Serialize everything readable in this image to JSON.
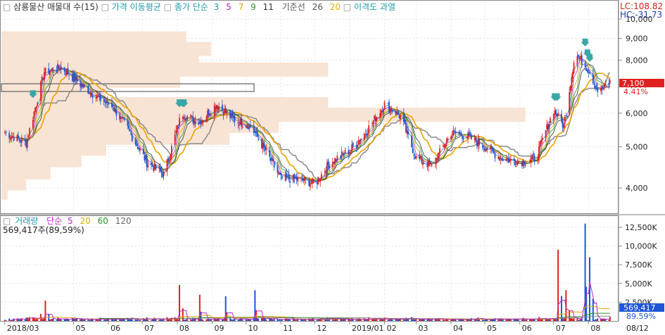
{
  "price_panel": {
    "legend": {
      "title": "삼룡물산 매물대 수(15)",
      "ma_title": "가격 이동평균",
      "ma_type": "종가 단순",
      "periods": [
        "3",
        "5",
        "7",
        "9",
        "11"
      ],
      "base_label": "기준선",
      "base_values": [
        "26",
        "20"
      ],
      "disparity": "이격도 과열"
    },
    "lc": "LC:108.82",
    "hc": "HC:-31.73",
    "price_badge": "7,100",
    "change_pct": "4.41%"
  },
  "volume_panel": {
    "legend": {
      "label": "거래량",
      "type": "단순",
      "periods": [
        "5",
        "20",
        "60",
        "120"
      ]
    },
    "info": "569,417주(89,59%)",
    "badge_value": "569,417",
    "badge_pct": "89.59%"
  },
  "chart_data": [
    {
      "type": "candlestick",
      "title": "삼룡물산 매물대 수(15)",
      "y_scale": "log",
      "ylim": [
        3500,
        11000
      ],
      "y_ticks": [
        "10,000",
        "9,000",
        "8,000",
        "7,000",
        "6,000",
        "5,000",
        "4,000"
      ],
      "y_tick_values": [
        10000,
        9000,
        8000,
        7000,
        6000,
        5000,
        4000
      ],
      "x_ticks": [
        "2018/03",
        "05",
        "06",
        "07",
        "08",
        "09",
        "10",
        "11",
        "12",
        "2019/01",
        "02",
        "03",
        "04",
        "05",
        "06",
        "07",
        "08"
      ],
      "x_tick_dates": [
        "2018-03",
        "2018-05",
        "2018-06",
        "2018-07",
        "2018-08",
        "2018-09",
        "2018-10",
        "2018-11",
        "2018-12",
        "2019-01",
        "2019-02",
        "2019-03",
        "2019-04",
        "2019-05",
        "2019-06",
        "2019-07",
        "2019-08"
      ],
      "close_series": {
        "dates": [
          "2018-03-01",
          "2018-03-20",
          "2018-04-05",
          "2018-04-20",
          "2018-05-05",
          "2018-05-20",
          "2018-06-05",
          "2018-06-20",
          "2018-07-05",
          "2018-07-20",
          "2018-08-05",
          "2018-08-20",
          "2018-09-05",
          "2018-09-20",
          "2018-10-05",
          "2018-10-20",
          "2018-11-01",
          "2018-11-15",
          "2018-12-01",
          "2018-12-15",
          "2019-01-01",
          "2019-01-15",
          "2019-02-01",
          "2019-02-15",
          "2019-03-01",
          "2019-03-15",
          "2019-04-01",
          "2019-04-15",
          "2019-05-01",
          "2019-05-15",
          "2019-06-01",
          "2019-06-15",
          "2019-07-01",
          "2019-07-10",
          "2019-07-20",
          "2019-08-01",
          "2019-08-10",
          "2019-08-20"
        ],
        "values": [
          5400,
          5100,
          7500,
          7700,
          7100,
          6600,
          6200,
          5400,
          4600,
          4300,
          6000,
          5700,
          6300,
          5800,
          5600,
          4800,
          4200,
          4200,
          4100,
          4600,
          4900,
          5400,
          6300,
          5900,
          4700,
          4500,
          5400,
          5300,
          5000,
          4700,
          4600,
          4700,
          6100,
          5600,
          8300,
          7600,
          6700,
          7100
        ]
      },
      "volume_profile": {
        "price_levels": [
          3900,
          4100,
          4350,
          4650,
          4950,
          5250,
          5600,
          5950,
          6300,
          6700,
          7150,
          7600,
          8050,
          8500,
          9000
        ],
        "relative_volume": [
          0.01,
          0.04,
          0.08,
          0.13,
          0.17,
          0.37,
          0.45,
          0.85,
          0.53,
          0.17,
          0.29,
          0.53,
          0.32,
          0.34,
          0.3
        ]
      },
      "markers": {
        "direction": "down",
        "color": "#3aa6a6",
        "dates": [
          "2018-03-25",
          "2018-08-03",
          "2018-08-05",
          "2018-08-07",
          "2019-07-02",
          "2019-07-04",
          "2019-07-28",
          "2019-07-31",
          "2019-08-02"
        ]
      }
    },
    {
      "type": "bar",
      "title": "거래량",
      "ylim": [
        0,
        14000000
      ],
      "y_ticks": [
        "12,500K",
        "10,000K",
        "7,500K",
        "5,000K",
        "2,500K"
      ],
      "y_tick_values": [
        12500000,
        10000000,
        7500000,
        5000000,
        2500000
      ],
      "x_ticks": [
        "2018/03",
        "05",
        "06",
        "07",
        "08",
        "09",
        "10",
        "11",
        "12",
        "2019/01",
        "02",
        "03",
        "04",
        "05",
        "06",
        "07",
        "08",
        "08/12"
      ],
      "spikes": {
        "dates": [
          "2018-04-06",
          "2018-08-03",
          "2018-08-21",
          "2018-09-13",
          "2018-10-09",
          "2019-07-05",
          "2019-07-13",
          "2019-07-28",
          "2019-08-02"
        ],
        "values": [
          2700000,
          4800000,
          3500000,
          3300000,
          4100000,
          9500000,
          4100000,
          13000000,
          8500000
        ]
      },
      "last_value": 569417,
      "last_pct": "89.59%"
    }
  ]
}
